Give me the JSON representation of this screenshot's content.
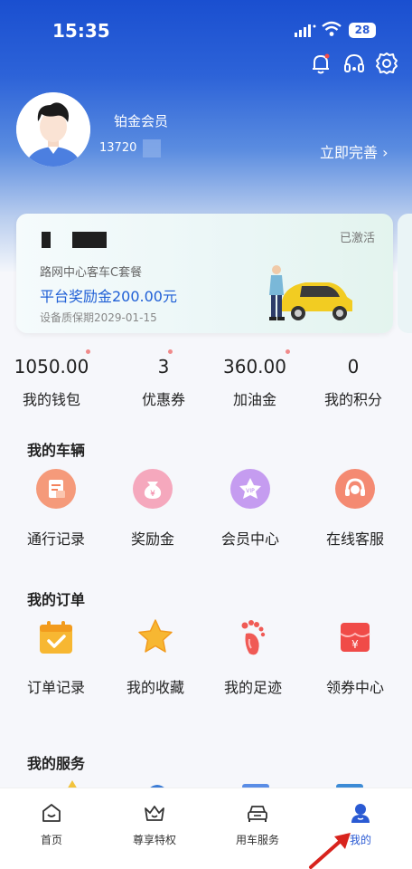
{
  "status_bar": {
    "time": "15:35",
    "battery": "28"
  },
  "profile": {
    "member_level": "铂金会员",
    "phone": "13720",
    "complete_link": "立即完善 ›"
  },
  "card": {
    "status": "已激活",
    "package": "路网中心客车C套餐",
    "reward": "平台奖励金200.00元",
    "warranty": "设备质保期2029-01-15"
  },
  "stats": [
    {
      "value": "1050.00",
      "label": "我的钱包"
    },
    {
      "value": "3",
      "label": "优惠券"
    },
    {
      "value": "360.00",
      "label": "加油金"
    },
    {
      "value": "0",
      "label": "我的积分"
    }
  ],
  "vehicle_section": {
    "title": "我的车辆",
    "items": [
      {
        "label": "通行记录",
        "icon": "record-icon",
        "color": "#f4825b"
      },
      {
        "label": "奖励金",
        "icon": "money-bag-icon",
        "color": "#f1779a"
      },
      {
        "label": "会员中心",
        "icon": "vip-icon",
        "color": "#b07ee8"
      },
      {
        "label": "在线客服",
        "icon": "headset-icon",
        "color": "#f16a4f"
      }
    ]
  },
  "orders_section": {
    "title": "我的订单",
    "items": [
      {
        "label": "订单记录",
        "icon": "order-record-icon"
      },
      {
        "label": "我的收藏",
        "icon": "star-icon"
      },
      {
        "label": "我的足迹",
        "icon": "footprint-icon"
      },
      {
        "label": "领券中心",
        "icon": "coupon-icon"
      }
    ]
  },
  "services_section": {
    "title": "我的服务"
  },
  "nav": [
    {
      "label": "首页",
      "icon": "home-icon",
      "active": false
    },
    {
      "label": "尊享特权",
      "icon": "crown-icon",
      "active": false
    },
    {
      "label": "用车服务",
      "icon": "car-icon",
      "active": false
    },
    {
      "label": "我的",
      "icon": "profile-icon",
      "active": true
    }
  ],
  "colors": {
    "accent": "#2a5ad3",
    "header_top": "#1a4fd0",
    "dot": "#f08a8a"
  }
}
